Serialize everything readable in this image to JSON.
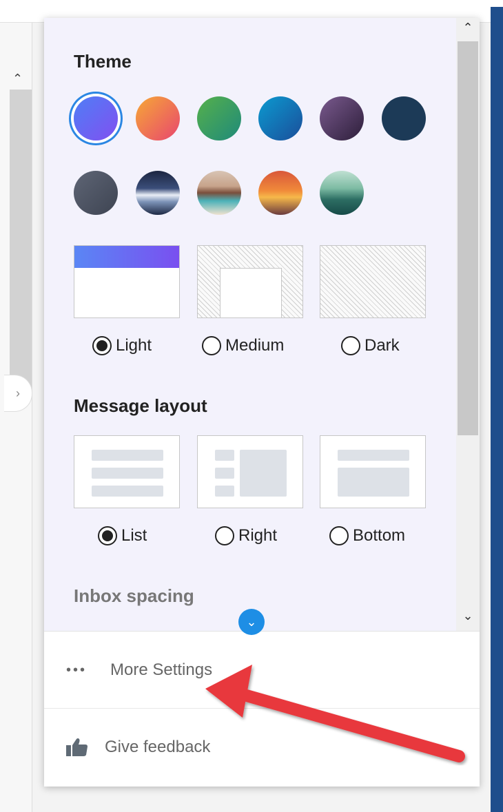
{
  "theme": {
    "title": "Theme",
    "swatches_row1": [
      "blue-purple",
      "orange-pink",
      "green",
      "blue",
      "purple",
      "navy"
    ],
    "swatches_row2": [
      "gray",
      "mountains",
      "camper",
      "sunset",
      "lake"
    ],
    "selected": "blue-purple",
    "colors": [
      "#6f63f5",
      "#f28a3a",
      "#3aa36a",
      "#0d7ec2",
      "#5a3d6e",
      "#1d3f5e",
      "#4e5565"
    ]
  },
  "mode": {
    "options": [
      {
        "label": "Light",
        "selected": true
      },
      {
        "label": "Medium",
        "selected": false
      },
      {
        "label": "Dark",
        "selected": false
      }
    ]
  },
  "layout": {
    "title": "Message layout",
    "options": [
      {
        "label": "List",
        "selected": true
      },
      {
        "label": "Right",
        "selected": false
      },
      {
        "label": "Bottom",
        "selected": false
      }
    ]
  },
  "spacing": {
    "title": "Inbox spacing"
  },
  "footer": {
    "more_settings": "More Settings",
    "give_feedback": "Give feedback"
  },
  "accent": "#2b87e3",
  "annotation_color": "#e8383d"
}
